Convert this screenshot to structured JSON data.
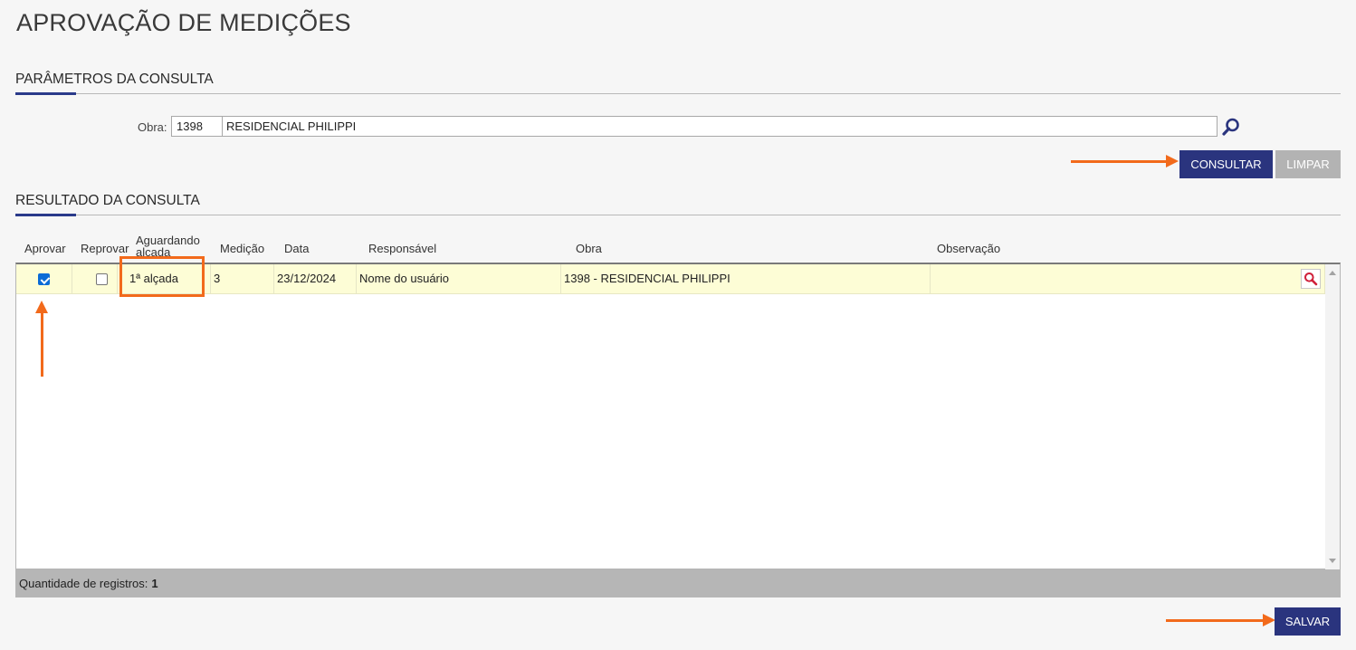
{
  "page": {
    "title": "APROVAÇÃO DE MEDIÇÕES"
  },
  "params": {
    "section_title": "PARÂMETROS DA CONSULTA",
    "obra_label": "Obra:",
    "obra_code": "1398",
    "obra_name": "RESIDENCIAL PHILIPPI",
    "consultar_label": "CONSULTAR",
    "limpar_label": "LIMPAR"
  },
  "results": {
    "section_title": "RESULTADO DA CONSULTA",
    "columns": {
      "aprovar": "Aprovar",
      "reprovar": "Reprovar",
      "aguardando": "Aguardando alçada",
      "medicao": "Medição",
      "data": "Data",
      "responsavel": "Responsável",
      "obra": "Obra",
      "observacao": "Observação"
    },
    "rows": [
      {
        "aprovar": true,
        "reprovar": false,
        "aguardando": "1ª alçada",
        "medicao": "3",
        "data": "23/12/2024",
        "responsavel": "Nome do usuário",
        "obra": "1398 - RESIDENCIAL PHILIPPI",
        "observacao": ""
      }
    ],
    "count_label": "Quantidade de registros:",
    "count_value": "1"
  },
  "actions": {
    "salvar_label": "SALVAR"
  },
  "colors": {
    "primary": "#2a347e",
    "disabled": "#b3b3b3",
    "annotation": "#f26a1b",
    "row_highlight": "#fdfdd6"
  }
}
